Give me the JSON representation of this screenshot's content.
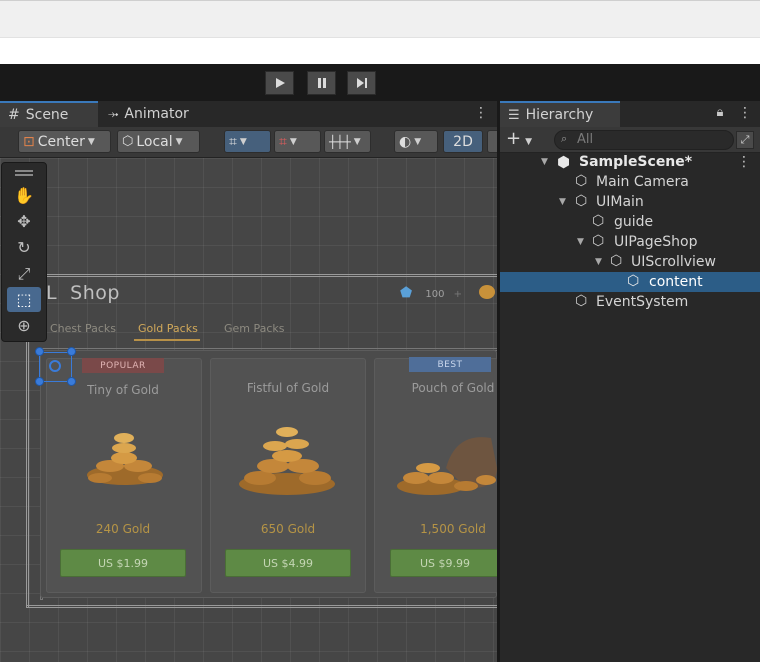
{
  "player": {
    "play_icon": "play-icon",
    "pause_icon": "pause-icon",
    "step_icon": "step-icon"
  },
  "scene_view": {
    "tabs": [
      {
        "icon": "grid-icon",
        "label": "Scene"
      },
      {
        "icon": "animator-icon",
        "label": "Animator"
      }
    ],
    "toolbar": {
      "pivot_label": "Center",
      "space_label": "Local",
      "mode_2d_label": "2D"
    },
    "tools": [
      "hand-tool",
      "move-tool",
      "rotate-tool",
      "scale-tool",
      "rect-tool",
      "transform-tool"
    ],
    "game": {
      "shop_title": "Shop",
      "gem_count": "100",
      "tabs": [
        {
          "label": "Chest Packs"
        },
        {
          "label": "Gold Packs"
        },
        {
          "label": "Gem Packs"
        }
      ],
      "cards": [
        {
          "badge": "POPULAR",
          "name": "Tiny of Gold",
          "amount": "240 Gold",
          "price": "US $1.99"
        },
        {
          "badge": "",
          "name": "Fistful of Gold",
          "amount": "650 Gold",
          "price": "US $4.99"
        },
        {
          "badge": "BEST",
          "name": "Pouch of Gold",
          "amount": "1,500 Gold",
          "price": "US $9.99"
        }
      ]
    }
  },
  "hierarchy": {
    "tab_label": "Hierarchy",
    "search_placeholder": "All",
    "items": [
      {
        "label": "SampleScene*",
        "bold": true,
        "expanded": true
      },
      {
        "label": "Main Camera"
      },
      {
        "label": "UIMain",
        "expanded": true
      },
      {
        "label": "guide"
      },
      {
        "label": "UIPageShop",
        "expanded": true
      },
      {
        "label": "UIScrollview",
        "expanded": true
      },
      {
        "label": "content",
        "selected": true
      },
      {
        "label": "EventSystem"
      }
    ]
  },
  "colors": {
    "selection": "#2c5d87",
    "accent_blue": "#3a79bb",
    "gold_text": "#b59446",
    "buy_green": "#5e8a45"
  }
}
